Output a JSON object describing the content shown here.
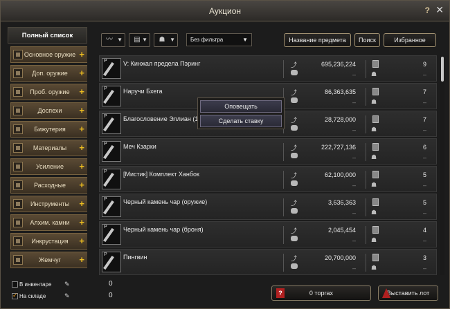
{
  "window": {
    "title": "Аукцион",
    "help": "?",
    "close": "✕"
  },
  "sidebar": {
    "title": "Полный список",
    "categories": [
      "Основное оружие",
      "Доп. оружие",
      "Проб. оружие",
      "Доспехи",
      "Бижутерия",
      "Материалы",
      "Усиление",
      "Расходные",
      "Инструменты",
      "Алхим. камни",
      "Инкрустация",
      "Жемчуг"
    ]
  },
  "toolbar": {
    "filter_value": "Без фильтра",
    "item_name_label": "Название предмета",
    "search_label": "Поиск",
    "favorites_label": "Избранное"
  },
  "items": [
    {
      "name": "V: Кинжал предела Пэринг",
      "price": "695,236,224",
      "price2": "–",
      "count": "9",
      "count2": "–"
    },
    {
      "name": "Наручи Бхега",
      "price": "86,363,635",
      "price2": "–",
      "count": "7",
      "count2": "–"
    },
    {
      "name": "Благословение Эллиан (15",
      "price": "28,728,000",
      "price2": "–",
      "count": "7",
      "count2": "–"
    },
    {
      "name": "Меч Кзарки",
      "price": "222,727,136",
      "price2": "–",
      "count": "6",
      "count2": "–"
    },
    {
      "name": "[Мистик] Комплект Ханбок",
      "price": "62,100,000",
      "price2": "–",
      "count": "5",
      "count2": "–"
    },
    {
      "name": "Черный камень чар (оружие)",
      "price": "3,636,363",
      "price2": "–",
      "count": "5",
      "count2": "–"
    },
    {
      "name": "Черный камень чар (броня)",
      "price": "2,045,454",
      "price2": "–",
      "count": "4",
      "count2": "–"
    },
    {
      "name": "Пингвин",
      "price": "20,700,000",
      "price2": "–",
      "count": "3",
      "count2": "–"
    }
  ],
  "context_menu": {
    "notify": "Оповещать",
    "bid": "Сделать ставку"
  },
  "bottom": {
    "inventory_label": "В инвентаре",
    "inventory_value": "0",
    "warehouse_label": "На складе",
    "warehouse_value": "0",
    "trades_label": "0 торгах",
    "post_label": "Выставить лот"
  }
}
